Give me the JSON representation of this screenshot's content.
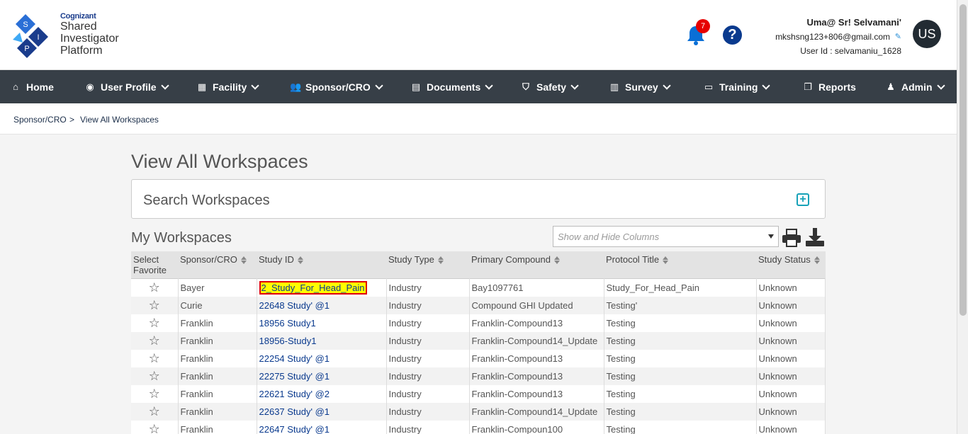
{
  "header": {
    "brand": "Cognizant",
    "app_name_1": "Shared",
    "app_name_2": "Investigator",
    "app_name_3": "Platform",
    "notification_count": "7",
    "help_glyph": "?",
    "user_name": "Uma@ Sr! Selvamani'",
    "user_email": "mkshsng123+806@gmail.com",
    "user_id": "User Id : selvamaniu_1628",
    "avatar_initials": "US"
  },
  "nav": {
    "items": [
      {
        "label": "Home",
        "icon": "home-icon"
      },
      {
        "label": "User Profile",
        "icon": "user-circle-icon"
      },
      {
        "label": "Facility",
        "icon": "building-icon"
      },
      {
        "label": "Sponsor/CRO",
        "icon": "users-icon"
      },
      {
        "label": "Documents",
        "icon": "file-icon"
      },
      {
        "label": "Safety",
        "icon": "shield-icon"
      },
      {
        "label": "Survey",
        "icon": "bar-chart-icon"
      },
      {
        "label": "Training",
        "icon": "laptop-icon"
      },
      {
        "label": "Reports",
        "icon": "copy-icon"
      },
      {
        "label": "Admin",
        "icon": "user-icon"
      }
    ]
  },
  "breadcrumb": {
    "parent": "Sponsor/CRO",
    "separator": ">",
    "current": "View All Workspaces"
  },
  "page": {
    "title": "View All Workspaces",
    "search_panel_label": "Search Workspaces",
    "section_label": "My Workspaces",
    "columns_placeholder": "Show and Hide Columns"
  },
  "table": {
    "headers": [
      "Select Favorite",
      "Sponsor/CRO",
      "Study ID",
      "Study Type",
      "Primary Compound",
      "Protocol Title",
      "Study Status"
    ],
    "rows": [
      {
        "sponsor": "Bayer",
        "study_id": "2_Study_For_Head_Pain",
        "type": "Industry",
        "compound": "Bay1097761",
        "title": "Study_For_Head_Pain",
        "status": "Unknown"
      },
      {
        "sponsor": "Curie",
        "study_id": "22648 Study' @1",
        "type": "Industry",
        "compound": "Compound GHI Updated",
        "title": "Testing'",
        "status": "Unknown"
      },
      {
        "sponsor": "Franklin",
        "study_id": "18956 Study1",
        "type": "Industry",
        "compound": "Franklin-Compound13",
        "title": "Testing",
        "status": "Unknown"
      },
      {
        "sponsor": "Franklin",
        "study_id": "18956-Study1",
        "type": "Industry",
        "compound": "Franklin-Compound14_Update",
        "title": "Testing",
        "status": "Unknown"
      },
      {
        "sponsor": "Franklin",
        "study_id": "22254 Study' @1",
        "type": "Industry",
        "compound": "Franklin-Compound13",
        "title": "Testing",
        "status": "Unknown"
      },
      {
        "sponsor": "Franklin",
        "study_id": "22275 Study' @1",
        "type": "Industry",
        "compound": "Franklin-Compound13",
        "title": "Testing",
        "status": "Unknown"
      },
      {
        "sponsor": "Franklin",
        "study_id": "22621 Study' @2",
        "type": "Industry",
        "compound": "Franklin-Compound13",
        "title": "Testing",
        "status": "Unknown"
      },
      {
        "sponsor": "Franklin",
        "study_id": "22637 Study' @1",
        "type": "Industry",
        "compound": "Franklin-Compound14_Update",
        "title": "Testing",
        "status": "Unknown"
      },
      {
        "sponsor": "Franklin",
        "study_id": "22647 Study' @1",
        "type": "Industry",
        "compound": "Franklin-Compoun100",
        "title": "Testing",
        "status": "Unknown"
      }
    ]
  },
  "colors": {
    "nav_bg": "#373f47",
    "link": "#0a3a8e",
    "highlight": "#ffff00",
    "badge": "#e60000"
  }
}
